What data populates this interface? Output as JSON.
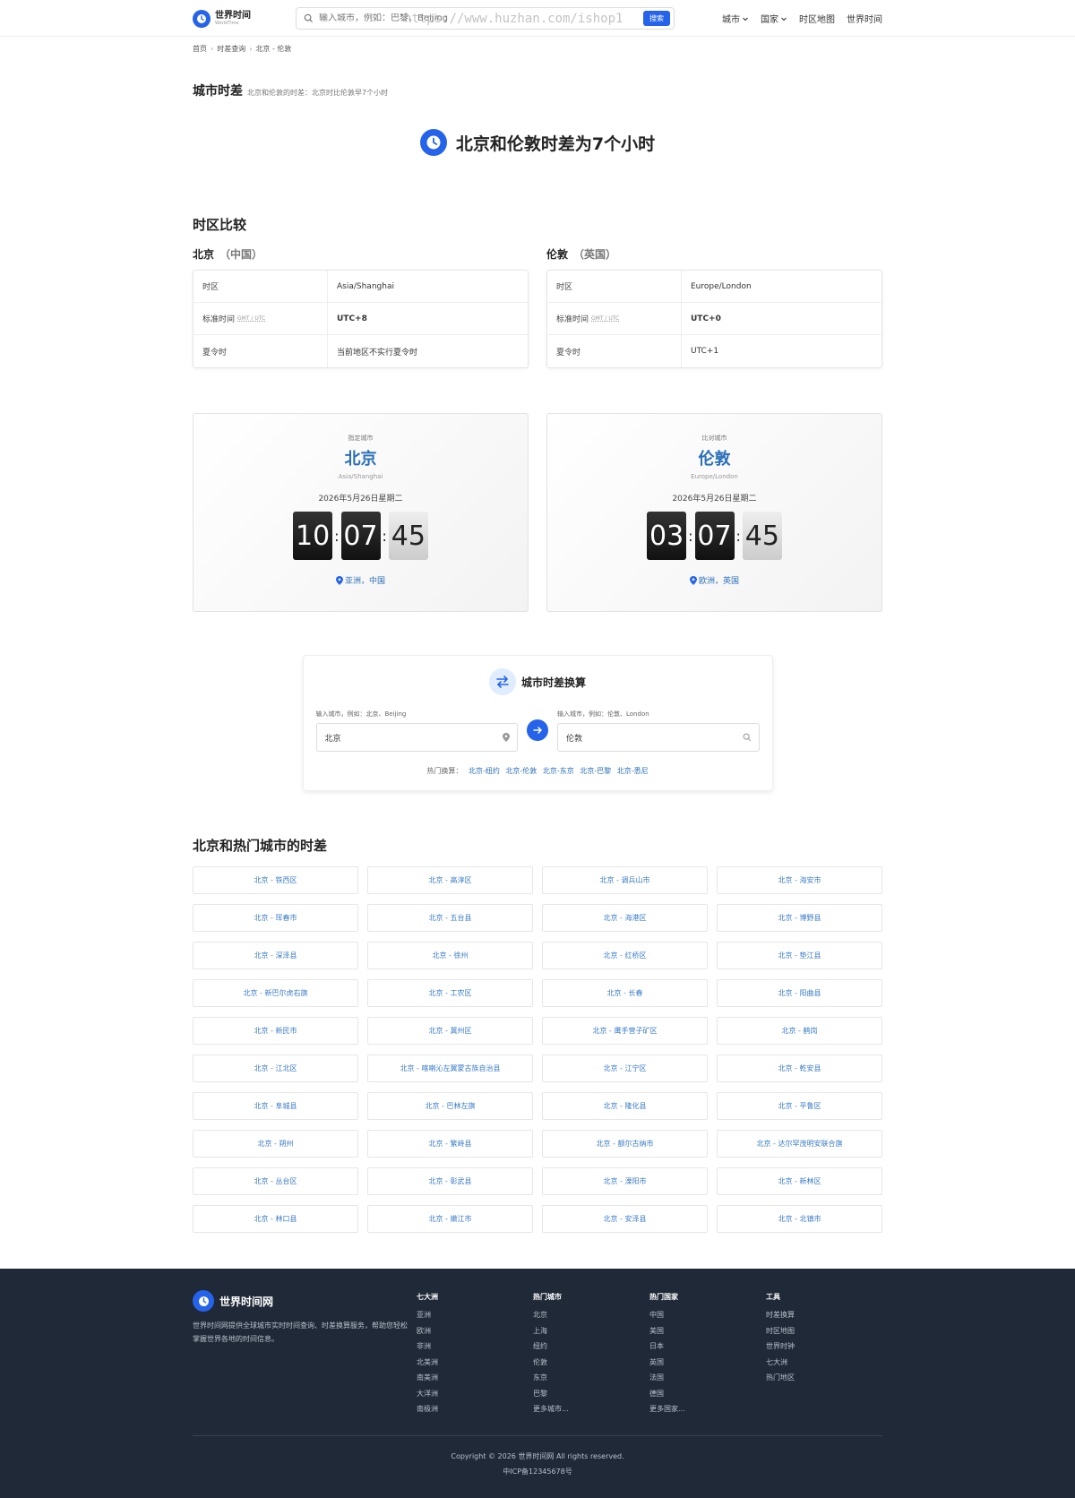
{
  "header": {
    "logo_name": "世界时间",
    "logo_sub": "WorldTime",
    "search_placeholder": "输入城市，例如：巴黎、Beijing",
    "search_button": "搜索",
    "watermark": "https://www.huzhan.com/ishop1",
    "nav": [
      "城市",
      "国家",
      "时区地图",
      "世界时间"
    ]
  },
  "breadcrumb": [
    "首页",
    "时差查询",
    "北京 - 伦敦"
  ],
  "title": {
    "main": "城市时差",
    "sub": "北京和伦敦的时差：北京时比伦敦早7个小时"
  },
  "headline": "北京和伦敦时差为7个小时",
  "compare": {
    "title": "时区比较",
    "left": {
      "city": "北京",
      "country": "（中国）",
      "rows": [
        {
          "k": "时区",
          "v": "Asia/Shanghai"
        },
        {
          "k": "标准时间",
          "k_small": "GMT / UTC",
          "v": "UTC+8"
        },
        {
          "k": "夏令时",
          "v": "当前地区不实行夏令时"
        }
      ]
    },
    "right": {
      "city": "伦敦",
      "country": "（英国）",
      "rows": [
        {
          "k": "时区",
          "v": "Europe/London"
        },
        {
          "k": "标准时间",
          "k_small": "GMT / UTC",
          "v": "UTC+0"
        },
        {
          "k": "夏令时",
          "v": "UTC+1"
        }
      ]
    }
  },
  "clocks": {
    "left": {
      "role": "指定城市",
      "city": "北京",
      "tz": "Asia/Shanghai",
      "date": "2026年5月26日星期二",
      "h": "10",
      "m": "07",
      "s": "45",
      "loc": "亚洲，中国"
    },
    "right": {
      "role": "比对城市",
      "city": "伦敦",
      "tz": "Europe/London",
      "date": "2026年5月26日星期二",
      "h": "03",
      "m": "07",
      "s": "45",
      "loc": "欧洲，英国"
    }
  },
  "converter": {
    "title": "城市时差换算",
    "left_label": "输入城市，例如：北京、Beijing",
    "left_value": "北京",
    "right_label": "输入城市，例如：伦敦、London",
    "right_value": "伦敦",
    "hot_label": "热门换算：",
    "hot_links": [
      "北京-纽约",
      "北京-伦敦",
      "北京-东京",
      "北京-巴黎",
      "北京-悉尼"
    ]
  },
  "hot_section": {
    "title": "北京和热门城市的时差",
    "items": [
      "北京 - 铁西区",
      "北京 - 高淳区",
      "北京 - 调兵山市",
      "北京 - 海安市",
      "北京 - 珲春市",
      "北京 - 五台县",
      "北京 - 海港区",
      "北京 - 博野县",
      "北京 - 深泽县",
      "北京 - 徐州",
      "北京 - 红桥区",
      "北京 - 垫江县",
      "北京 - 新巴尔虎右旗",
      "北京 - 工农区",
      "北京 - 长春",
      "北京 - 阳曲县",
      "北京 - 新民市",
      "北京 - 冀州区",
      "北京 - 鹰手营子矿区",
      "北京 - 鹤岗",
      "北京 - 江北区",
      "北京 - 喀喇沁左翼蒙古族自治县",
      "北京 - 江宁区",
      "北京 - 乾安县",
      "北京 - 阜城县",
      "北京 - 巴林左旗",
      "北京 - 隆化县",
      "北京 - 平鲁区",
      "北京 - 朔州",
      "北京 - 繁峙县",
      "北京 - 额尔古纳市",
      "北京 - 达尔罕茂明安联合旗",
      "北京 - 丛台区",
      "北京 - 彰武县",
      "北京 - 溧阳市",
      "北京 - 新林区",
      "北京 - 林口县",
      "北京 - 嫩江市",
      "北京 - 安泽县",
      "北京 - 北镇市"
    ]
  },
  "footer": {
    "name": "世界时间网",
    "desc": "世界时间网提供全球城市实时时间查询、时差换算服务，帮助您轻松掌握世界各地的时间信息。",
    "cols": [
      {
        "title": "七大洲",
        "items": [
          "亚洲",
          "欧洲",
          "非洲",
          "北美洲",
          "南美洲",
          "大洋洲",
          "南极洲"
        ]
      },
      {
        "title": "热门城市",
        "items": [
          "北京",
          "上海",
          "纽约",
          "伦敦",
          "东京",
          "巴黎",
          "更多城市..."
        ]
      },
      {
        "title": "热门国家",
        "items": [
          "中国",
          "美国",
          "日本",
          "英国",
          "法国",
          "德国",
          "更多国家..."
        ]
      },
      {
        "title": "工具",
        "items": [
          "时差换算",
          "时区地图",
          "世界时钟",
          "七大洲",
          "热门地区"
        ]
      }
    ],
    "copyright": "Copyright © 2026 世界时间网 All rights reserved.",
    "icp": "中ICP备12345678号"
  },
  "colors": {
    "accent": "#2563eb",
    "link": "#2a6fb8",
    "footer_bg": "#1f2937"
  }
}
